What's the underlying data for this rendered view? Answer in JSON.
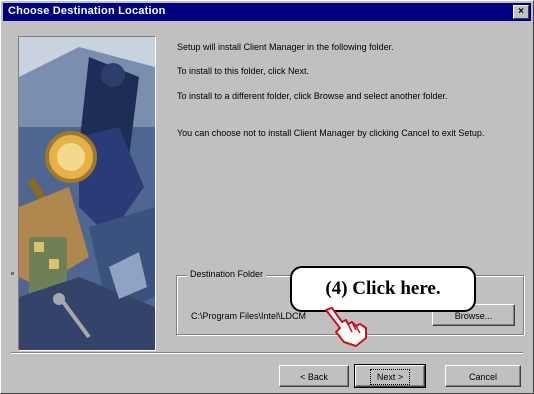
{
  "window": {
    "title": "Choose Destination Location",
    "close_glyph": "×"
  },
  "instructions": [
    "Setup will install Client Manager in the following folder.",
    "To install to this folder, click Next.",
    "To install to a different folder, click Browse and select another folder.",
    "You can choose not to install Client Manager by clicking Cancel to exit Setup."
  ],
  "destination": {
    "group_label": "Destination Folder",
    "path": "C:\\Program Files\\Intel\\LDCM",
    "browse_label": "Browse..."
  },
  "buttons": {
    "back": "< Back",
    "next": "Next >",
    "cancel": "Cancel"
  },
  "callout": {
    "text": "(4)  Click here."
  },
  "icons": {
    "art": "setup-illustration",
    "hand": "pointing-hand-icon"
  },
  "colors": {
    "titlebar": "#000080",
    "dialog_face": "#c0c0c0"
  }
}
